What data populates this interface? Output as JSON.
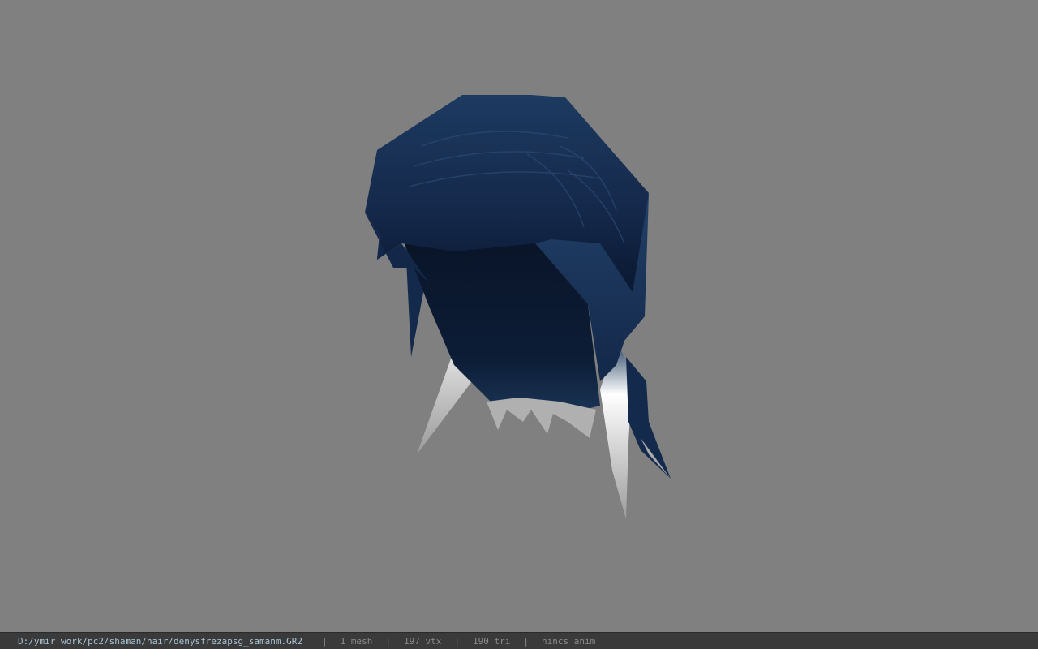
{
  "viewport": {
    "background_color": "#808080",
    "model": {
      "description_icon": "hair-mesh-3d-model",
      "hair_color": "#1a3356",
      "tip_color": "#d8d8d8"
    }
  },
  "status_bar": {
    "file_path": "D:/ymir work/pc2/shaman/hair/denysfrezapsg_samanm.GR2",
    "separator": "|",
    "mesh_count": "1 mesh",
    "vertex_count": "197 vtx",
    "triangle_count": "190 tri",
    "anim_status": "nincs anim"
  }
}
